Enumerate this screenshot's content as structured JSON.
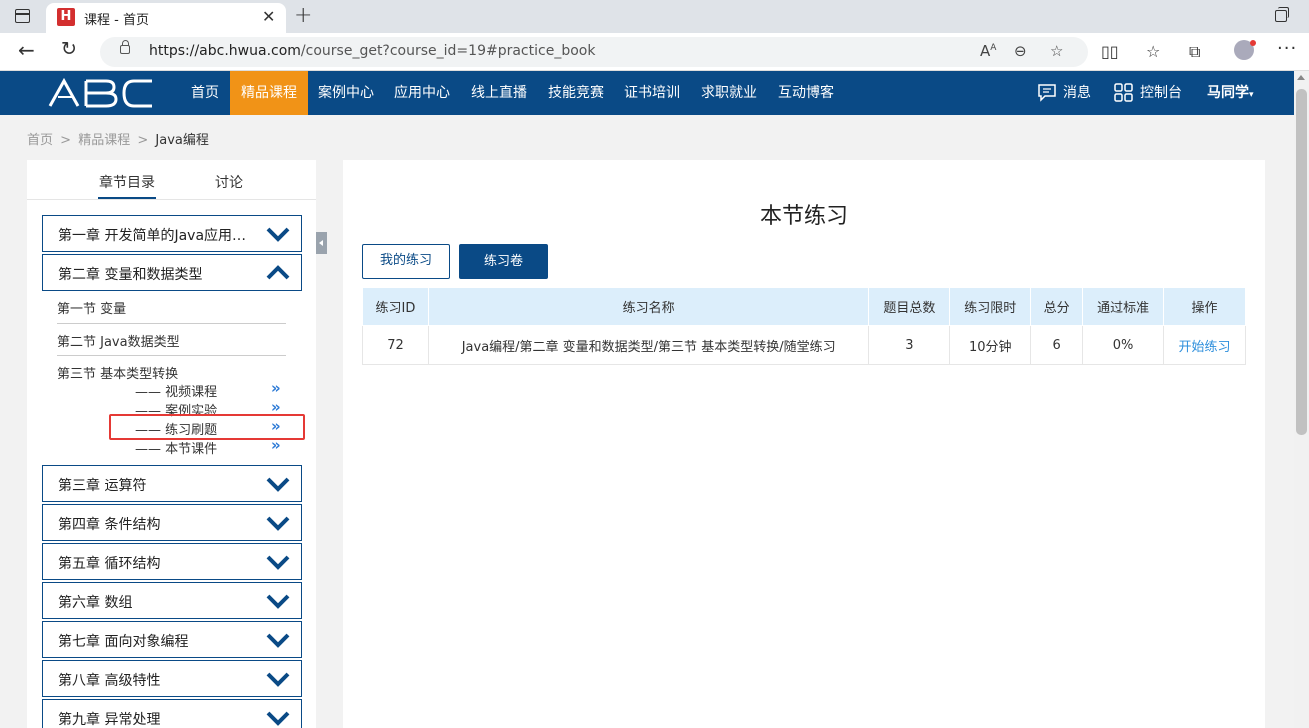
{
  "browser": {
    "tab_title": "课程 - 首页",
    "favicon_letter": "H",
    "close": "✕",
    "new_tab": "+",
    "url_host": "https://abc.hwua.com",
    "url_path": "/course_get?course_id=19#practice_book",
    "read_aloud": "A⁠A"
  },
  "header": {
    "logo": "ABC",
    "nav": [
      "首页",
      "精品课程",
      "案例中心",
      "应用中心",
      "线上直播",
      "技能竞赛",
      "证书培训",
      "求职就业",
      "互动博客"
    ],
    "messages": "消息",
    "console": "控制台",
    "user": "马同学"
  },
  "breadcrumb": {
    "home": "首页",
    "courses": "精品课程",
    "current": "Java编程",
    "sep": ">"
  },
  "sidebar": {
    "tabs": [
      "章节目录",
      "讨论"
    ],
    "chapters": [
      "第一章 开发简单的Java应用程序",
      "第二章 变量和数据类型",
      "第三章 运算符",
      "第四章 条件结构",
      "第五章 循环结构",
      "第六章 数组",
      "第七章 面向对象编程",
      "第八章 高级特性",
      "第九章 异常处理"
    ],
    "sections": [
      "第一节 变量",
      "第二节 Java数据类型",
      "第三节 基本类型转换"
    ],
    "subs": [
      "—— 视频课程",
      "—— 案例实验",
      "—— 练习刷题",
      "—— 本节课件"
    ],
    "arrow": "»"
  },
  "practice": {
    "title": "本节练习",
    "btn_my": "我的练习",
    "btn_paper": "练习卷",
    "columns": [
      "练习ID",
      "练习名称",
      "题目总数",
      "练习限时",
      "总分",
      "通过标准",
      "操作"
    ],
    "rows": [
      {
        "id": "72",
        "name": "Java编程/第二章 变量和数据类型/第三节 基本类型转换/随堂练习",
        "total": "3",
        "limit": "10分钟",
        "score": "6",
        "pass": "0%",
        "action": "开始练习"
      }
    ]
  },
  "colors": {
    "brand": "#0a4a86",
    "accent": "#f19317",
    "link": "#2e8fdc",
    "highlight": "#e53935"
  }
}
